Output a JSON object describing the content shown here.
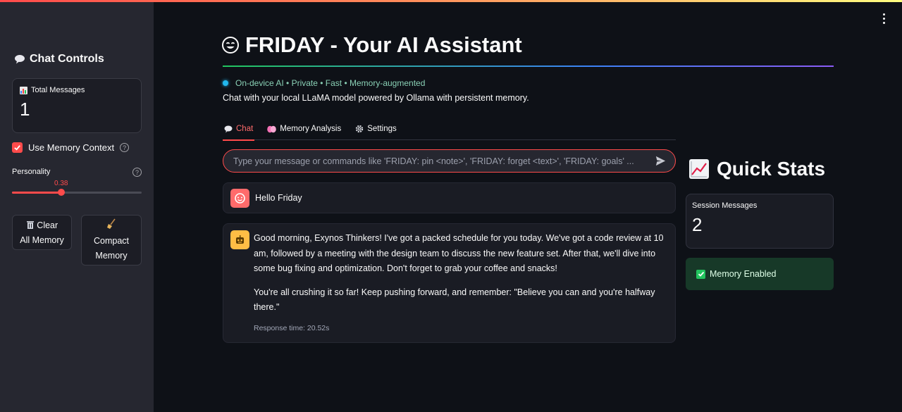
{
  "sidebar": {
    "title": "Chat Controls",
    "title_icon": "speech-bubble-icon",
    "total_messages": {
      "label": "Total Messages",
      "value": "1",
      "icon": "bar-chart-icon"
    },
    "use_memory": {
      "label": "Use Memory Context",
      "checked": true
    },
    "personality": {
      "label": "Personality",
      "value": "0.38",
      "fraction": 0.38
    },
    "clear_button": {
      "icon": "trash-icon",
      "label_line1": "Clear",
      "label_line2": "All Memory"
    },
    "compact_button": {
      "icon": "broom-icon",
      "label_line1": "Compact",
      "label_line2": "Memory"
    }
  },
  "header": {
    "title": "FRIDAY - Your AI Assistant",
    "tagline": "On-device AI • Private • Fast • Memory-augmented",
    "subtitle": "Chat with your local LLaMA model powered by Ollama with persistent memory."
  },
  "tabs": [
    {
      "label": "Chat",
      "icon": "speech-bubble-icon",
      "active": true
    },
    {
      "label": "Memory Analysis",
      "icon": "brain-icon",
      "active": false
    },
    {
      "label": "Settings",
      "icon": "gear-icon",
      "active": false
    }
  ],
  "chat_input": {
    "placeholder": "Type your message or commands like 'FRIDAY: pin <note>', 'FRIDAY: forget <text>', 'FRIDAY: goals' ..."
  },
  "messages": {
    "user": {
      "text": "Hello Friday"
    },
    "assistant": {
      "para1": "Good morning, Exynos Thinkers! I've got a packed schedule for you today. We've got a code review at 10 am, followed by a meeting with the design team to discuss the new feature set. After that, we'll dive into some bug fixing and optimization. Don't forget to grab your coffee and snacks!",
      "para2": "You're all crushing it so far! Keep pushing forward, and remember: \"Believe you can and you're halfway there.\"",
      "response_time": "Response time: 20.52s"
    }
  },
  "quick_stats": {
    "title": "Quick Stats",
    "session_messages": {
      "label": "Session Messages",
      "value": "2"
    },
    "memory_status": "Memory Enabled"
  },
  "colors": {
    "accent": "#ff4b4b",
    "success_bg": "#173928",
    "background": "#0e1117",
    "sidebar": "#262730"
  }
}
